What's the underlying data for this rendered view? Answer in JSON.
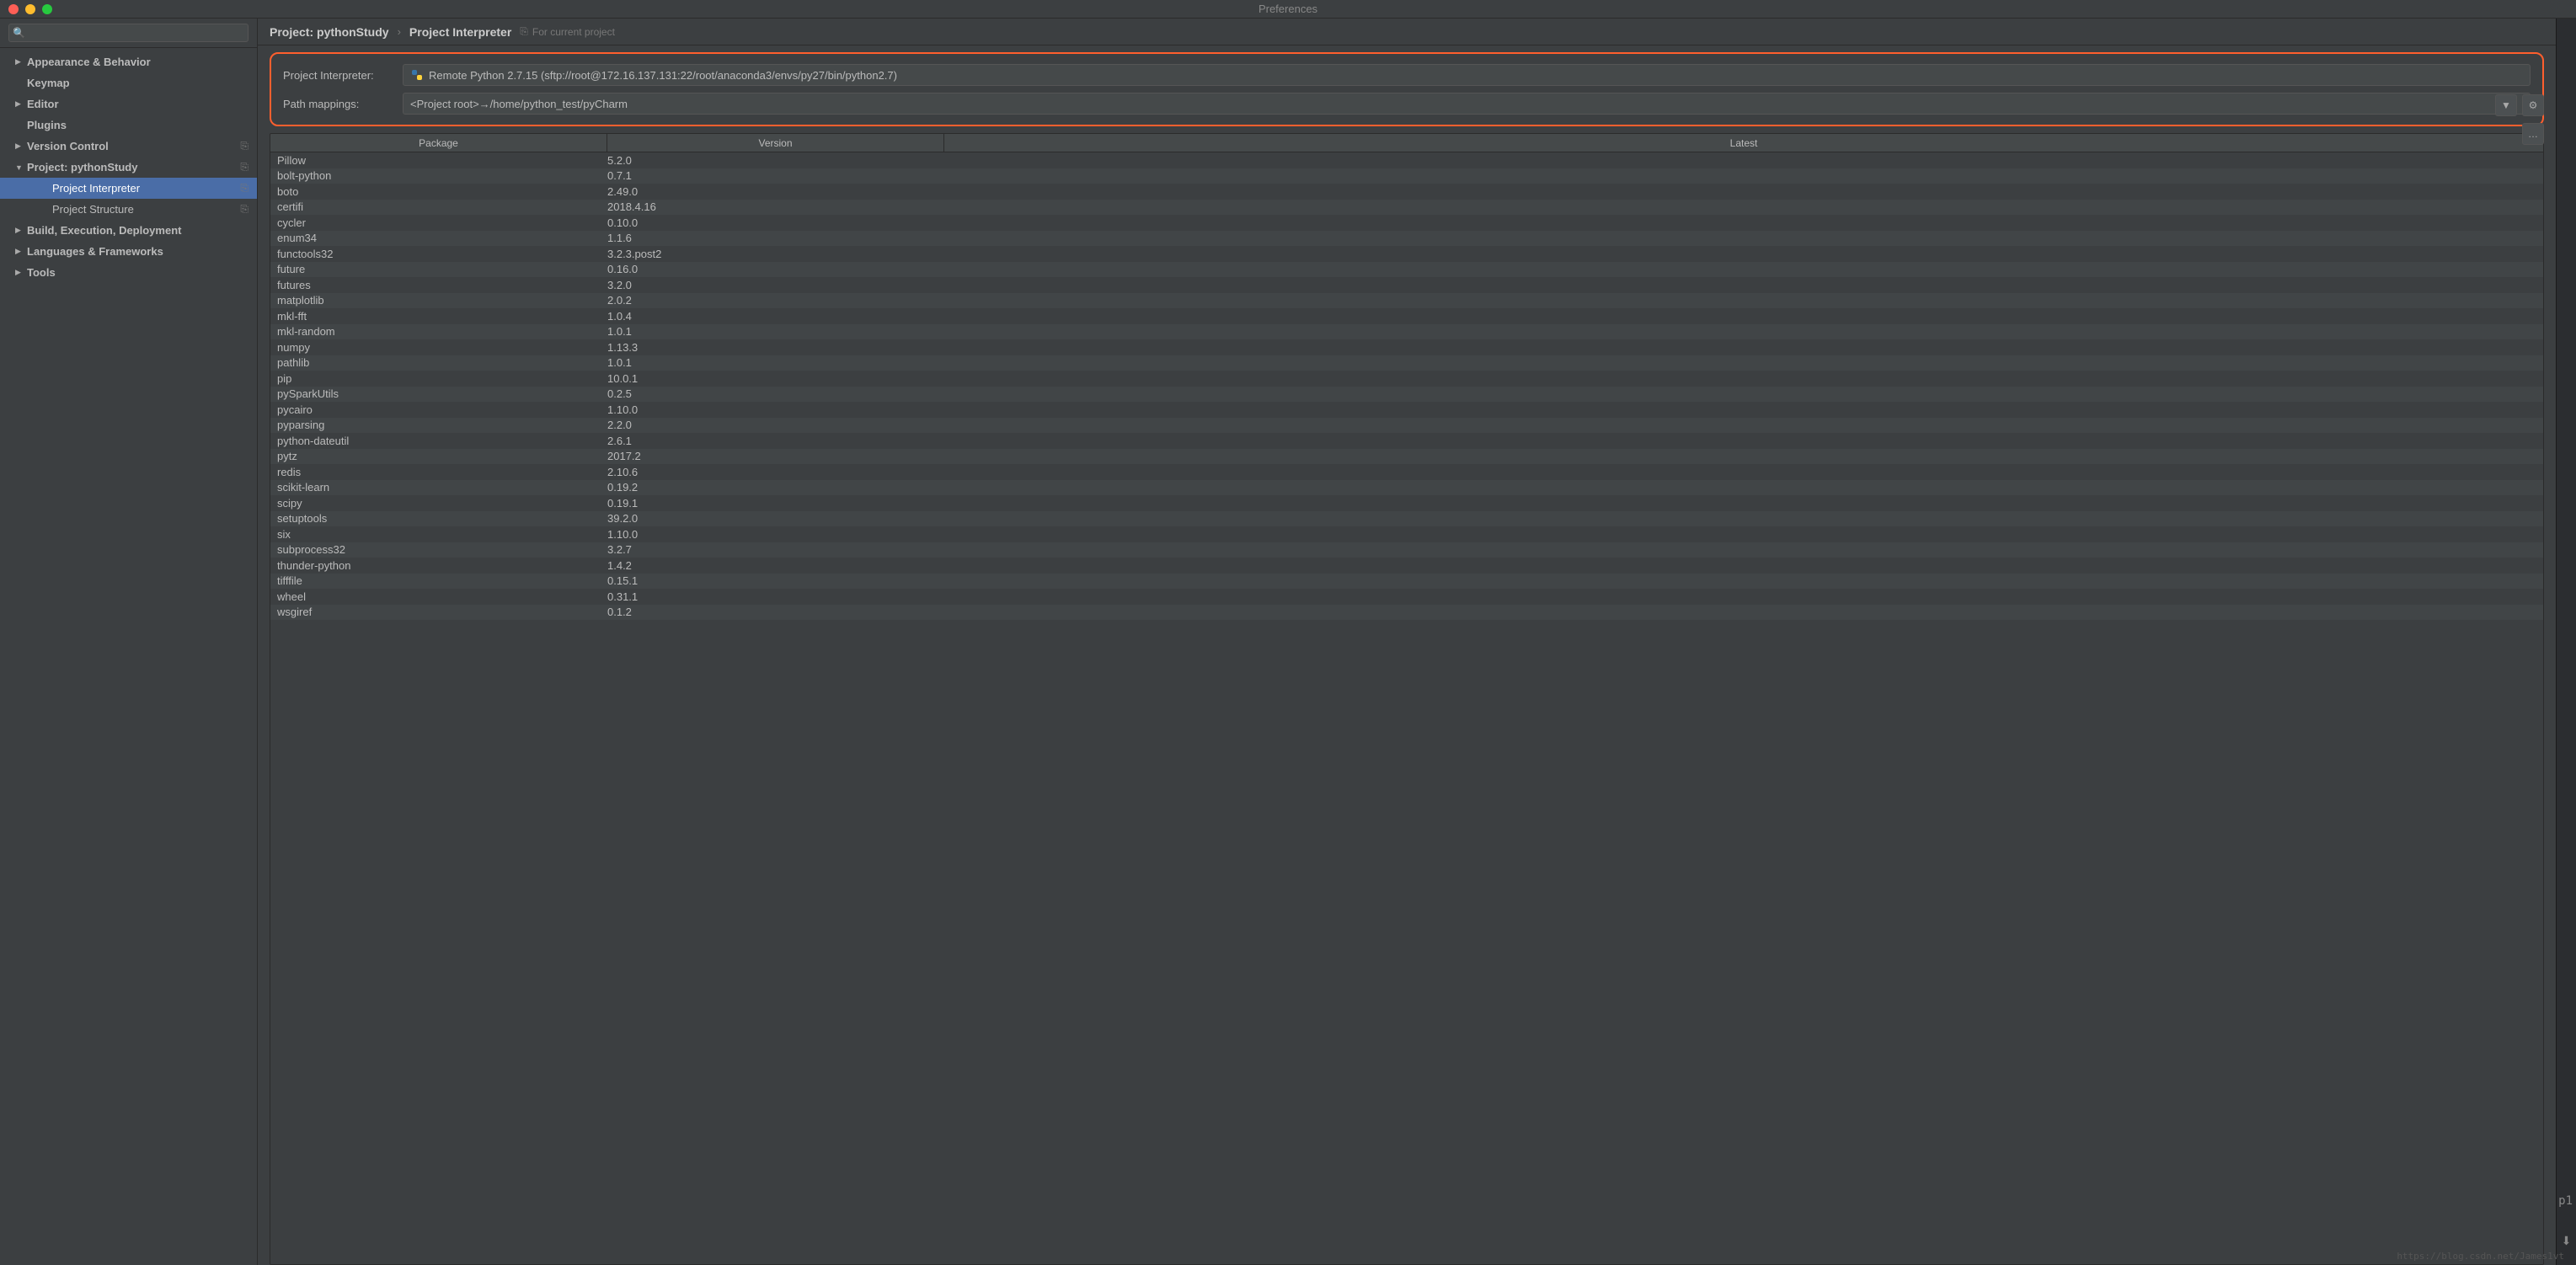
{
  "window": {
    "title": "Preferences"
  },
  "search": {
    "placeholder": ""
  },
  "sidebar": {
    "items": [
      {
        "label": "Appearance & Behavior",
        "arrow": "▶",
        "child": false
      },
      {
        "label": "Keymap",
        "arrow": "",
        "child": false
      },
      {
        "label": "Editor",
        "arrow": "▶",
        "child": false
      },
      {
        "label": "Plugins",
        "arrow": "",
        "child": false
      },
      {
        "label": "Version Control",
        "arrow": "▶",
        "child": false,
        "tag": "⎘"
      },
      {
        "label": "Project: pythonStudy",
        "arrow": "▼",
        "child": false,
        "tag": "⎘"
      },
      {
        "label": "Project Interpreter",
        "arrow": "",
        "child": true,
        "selected": true,
        "tag": "⎘"
      },
      {
        "label": "Project Structure",
        "arrow": "",
        "child": true,
        "tag": "⎘"
      },
      {
        "label": "Build, Execution, Deployment",
        "arrow": "▶",
        "child": false
      },
      {
        "label": "Languages & Frameworks",
        "arrow": "▶",
        "child": false
      },
      {
        "label": "Tools",
        "arrow": "▶",
        "child": false
      }
    ]
  },
  "breadcrumb": {
    "project": "Project: pythonStudy",
    "sep": "›",
    "page": "Project Interpreter",
    "for_project": "For current project"
  },
  "form": {
    "interpreter_label": "Project Interpreter:",
    "interpreter_value": "Remote Python 2.7.15 (sftp://root@172.16.137.131:22/root/anaconda3/envs/py27/bin/python2.7)",
    "path_label": "Path mappings:",
    "path_value": "<Project root>→/home/python_test/pyCharm"
  },
  "table": {
    "headers": {
      "package": "Package",
      "version": "Version",
      "latest": "Latest"
    },
    "rows": [
      {
        "pkg": "Pillow",
        "ver": "5.2.0"
      },
      {
        "pkg": "bolt-python",
        "ver": "0.7.1"
      },
      {
        "pkg": "boto",
        "ver": "2.49.0"
      },
      {
        "pkg": "certifi",
        "ver": "2018.4.16"
      },
      {
        "pkg": "cycler",
        "ver": "0.10.0"
      },
      {
        "pkg": "enum34",
        "ver": "1.1.6"
      },
      {
        "pkg": "functools32",
        "ver": "3.2.3.post2"
      },
      {
        "pkg": "future",
        "ver": "0.16.0"
      },
      {
        "pkg": "futures",
        "ver": "3.2.0"
      },
      {
        "pkg": "matplotlib",
        "ver": "2.0.2"
      },
      {
        "pkg": "mkl-fft",
        "ver": "1.0.4"
      },
      {
        "pkg": "mkl-random",
        "ver": "1.0.1"
      },
      {
        "pkg": "numpy",
        "ver": "1.13.3"
      },
      {
        "pkg": "pathlib",
        "ver": "1.0.1"
      },
      {
        "pkg": "pip",
        "ver": "10.0.1"
      },
      {
        "pkg": "pySparkUtils",
        "ver": "0.2.5"
      },
      {
        "pkg": "pycairo",
        "ver": "1.10.0"
      },
      {
        "pkg": "pyparsing",
        "ver": "2.2.0"
      },
      {
        "pkg": "python-dateutil",
        "ver": "2.6.1"
      },
      {
        "pkg": "pytz",
        "ver": "2017.2"
      },
      {
        "pkg": "redis",
        "ver": "2.10.6"
      },
      {
        "pkg": "scikit-learn",
        "ver": "0.19.2"
      },
      {
        "pkg": "scipy",
        "ver": "0.19.1"
      },
      {
        "pkg": "setuptools",
        "ver": "39.2.0"
      },
      {
        "pkg": "six",
        "ver": "1.10.0"
      },
      {
        "pkg": "subprocess32",
        "ver": "3.2.7"
      },
      {
        "pkg": "thunder-python",
        "ver": "1.4.2"
      },
      {
        "pkg": "tifffile",
        "ver": "0.15.1"
      },
      {
        "pkg": "wheel",
        "ver": "0.31.1"
      },
      {
        "pkg": "wsgiref",
        "ver": "0.1.2"
      }
    ]
  },
  "corner": {
    "text": "p1"
  },
  "watermark": "https://blog.csdn.net/James1vt"
}
